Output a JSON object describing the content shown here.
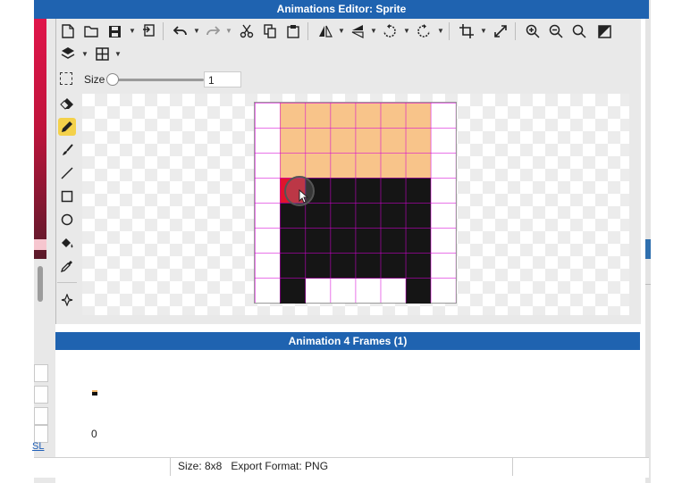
{
  "window": {
    "title": "Animations Editor: Sprite"
  },
  "toolbar": {
    "row1": [
      "new-file-icon",
      "open-folder-icon",
      "save-icon",
      "export-icon",
      "undo-icon",
      "redo-icon",
      "cut-icon",
      "copy-icon",
      "paste-icon",
      "flip-horizontal-icon",
      "flip-vertical-icon",
      "rotate-left-icon",
      "rotate-right-icon",
      "crop-icon",
      "resize-icon",
      "zoom-in-icon",
      "zoom-out-icon",
      "zoom-fit-icon",
      "fill-canvas-icon"
    ],
    "row2": [
      "layers-icon",
      "grid-icon"
    ]
  },
  "brush": {
    "size_label": "Size",
    "size_value": "1",
    "slider_fraction": 0.0
  },
  "tools": [
    "select-icon",
    "eraser-icon",
    "pencil-icon",
    "brush-icon",
    "line-icon",
    "rectangle-icon",
    "ellipse-icon",
    "fill-bucket-icon",
    "eyedropper-icon",
    "move-icon"
  ],
  "active_tool": "pencil-icon",
  "sprite": {
    "width": 8,
    "height": 8,
    "palette": {
      "0": null,
      "1": "#f8c48a",
      "2": "#151515",
      "3": "#e0142c"
    },
    "pixels": [
      [
        0,
        1,
        1,
        1,
        1,
        1,
        1,
        0
      ],
      [
        0,
        1,
        1,
        1,
        1,
        1,
        1,
        0
      ],
      [
        0,
        1,
        1,
        1,
        1,
        1,
        1,
        0
      ],
      [
        0,
        3,
        2,
        2,
        2,
        2,
        2,
        0
      ],
      [
        0,
        2,
        2,
        2,
        2,
        2,
        2,
        0
      ],
      [
        0,
        2,
        2,
        2,
        2,
        2,
        2,
        0
      ],
      [
        0,
        2,
        2,
        2,
        2,
        2,
        2,
        0
      ],
      [
        0,
        2,
        0,
        0,
        0,
        0,
        2,
        0
      ]
    ]
  },
  "animation": {
    "header": "Animation 4 Frames (1)",
    "frames": [
      {
        "index": "0"
      }
    ]
  },
  "status": {
    "text": "Size: 8x8   Export Format: PNG"
  },
  "background_app": {
    "link_text": "SL"
  }
}
